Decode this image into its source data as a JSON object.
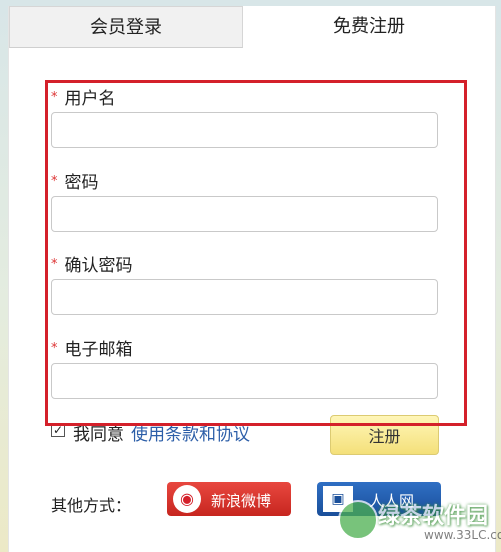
{
  "tabs": [
    {
      "label": "会员登录",
      "active": false
    },
    {
      "label": "免费注册",
      "active": true
    }
  ],
  "form": {
    "required_mark": "*",
    "fields": [
      {
        "label": "用户名",
        "value": "",
        "placeholder": ""
      },
      {
        "label": "密码",
        "value": "",
        "placeholder": ""
      },
      {
        "label": "确认密码",
        "value": "",
        "placeholder": ""
      },
      {
        "label": "电子邮箱",
        "value": "",
        "placeholder": ""
      }
    ],
    "agree": {
      "checked": true,
      "checkmark": "✓",
      "prefix": "我同意",
      "link": "使用条款和协议"
    },
    "register_label": "注册"
  },
  "social": {
    "label": "其他方式：",
    "weibo_label": "新浪微博",
    "renren_label": "人人网"
  },
  "watermark": {
    "text": "绿茶软件园",
    "url": "www.33LC.com"
  },
  "colors": {
    "highlight": "#d4202a",
    "link": "#2c5ea8",
    "register_button": "#f4e07a",
    "weibo": "#d4202a",
    "renren": "#1a4f9a"
  }
}
